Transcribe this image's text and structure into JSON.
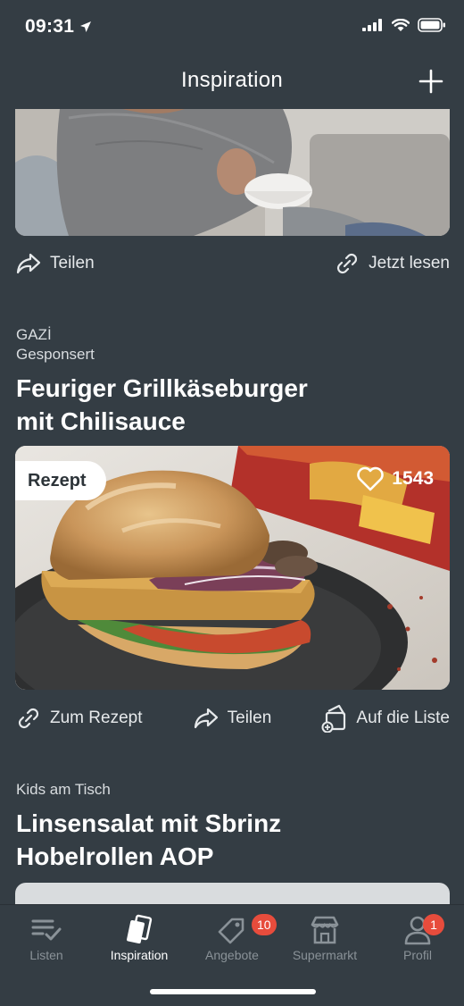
{
  "status_bar": {
    "time": "09:31"
  },
  "header": {
    "title": "Inspiration"
  },
  "article_1": {
    "share_label": "Teilen",
    "read_label": "Jetzt lesen"
  },
  "recipe_1": {
    "brand": "GAZİ",
    "sponsored": "Gesponsert",
    "title_line1": "Feuriger Grillkäseburger",
    "title_line2": "mit Chilisauce",
    "badge": "Rezept",
    "likes": "1543",
    "to_recipe_label": "Zum Rezept",
    "share_label": "Teilen",
    "add_to_list_label": "Auf die Liste"
  },
  "recipe_2": {
    "category": "Kids am Tisch",
    "title_line1": "Linsensalat mit Sbrinz",
    "title_line2": "Hobelrollen AOP"
  },
  "tabs": [
    {
      "label": "Listen",
      "icon": "list-check-icon"
    },
    {
      "label": "Inspiration",
      "icon": "cards-icon"
    },
    {
      "label": "Angebote",
      "icon": "tag-icon",
      "badge": "10"
    },
    {
      "label": "Supermarkt",
      "icon": "store-icon"
    },
    {
      "label": "Profil",
      "icon": "person-icon",
      "badge": "1"
    }
  ],
  "colors": {
    "background": "#343d44",
    "badge_red": "#e74c3c",
    "inactive_tab": "#8a9298"
  }
}
